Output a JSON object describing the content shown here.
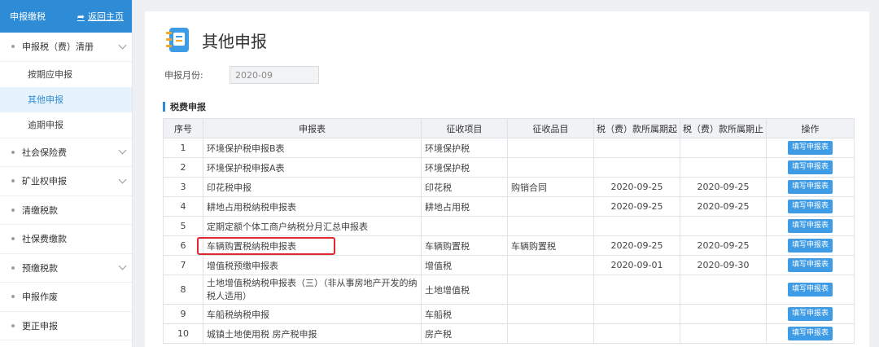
{
  "sidebar": {
    "header_title": "申报缴税",
    "back_label": "返回主页",
    "items": [
      {
        "label": "申报税（费）清册",
        "expandable": true
      },
      {
        "label": "社会保险费",
        "expandable": true
      },
      {
        "label": "矿业权申报",
        "expandable": true
      },
      {
        "label": "清缴税款",
        "expandable": false
      },
      {
        "label": "社保费缴款",
        "expandable": false
      },
      {
        "label": "预缴税款",
        "expandable": true
      },
      {
        "label": "申报作废",
        "expandable": false
      },
      {
        "label": "更正申报",
        "expandable": false
      }
    ],
    "subitems": [
      {
        "label": "按期应申报",
        "active": false
      },
      {
        "label": "其他申报",
        "active": true
      },
      {
        "label": "逾期申报",
        "active": false
      }
    ]
  },
  "main": {
    "title": "其他申报",
    "month_label": "申报月份:",
    "month_value": "2020-09",
    "section_title": "税费申报"
  },
  "table": {
    "headers": [
      "序号",
      "申报表",
      "征收项目",
      "征收品目",
      "税（费）款所属期起",
      "税（费）款所属期止",
      "操作"
    ],
    "rows": [
      {
        "no": "1",
        "form": "环境保护税申报B表",
        "project": "环境保护税",
        "item": "",
        "start": "",
        "end": "",
        "action": "填写申报表"
      },
      {
        "no": "2",
        "form": "环境保护税申报A表",
        "project": "环境保护税",
        "item": "",
        "start": "",
        "end": "",
        "action": "填写申报表"
      },
      {
        "no": "3",
        "form": "印花税申报",
        "project": "印花税",
        "item": "购销合同",
        "start": "2020-09-25",
        "end": "2020-09-25",
        "action": "填写申报表"
      },
      {
        "no": "4",
        "form": "耕地占用税纳税申报表",
        "project": "耕地占用税",
        "item": "",
        "start": "2020-09-25",
        "end": "2020-09-25",
        "action": "填写申报表"
      },
      {
        "no": "5",
        "form": "定期定额个体工商户纳税分月汇总申报表",
        "project": "",
        "item": "",
        "start": "",
        "end": "",
        "action": "填写申报表"
      },
      {
        "no": "6",
        "form": "车辆购置税纳税申报表",
        "project": "车辆购置税",
        "item": "车辆购置税",
        "start": "2020-09-25",
        "end": "2020-09-25",
        "action": "填写申报表"
      },
      {
        "no": "7",
        "form": "增值税预缴申报表",
        "project": "增值税",
        "item": "",
        "start": "2020-09-01",
        "end": "2020-09-30",
        "action": "填写申报表"
      },
      {
        "no": "8",
        "form": "土地增值税纳税申报表（三）（非从事房地产开发的纳税人适用）",
        "project": "土地增值税",
        "item": "",
        "start": "",
        "end": "",
        "action": "填写申报表"
      },
      {
        "no": "9",
        "form": "车船税纳税申报",
        "project": "车船税",
        "item": "",
        "start": "",
        "end": "",
        "action": "填写申报表"
      },
      {
        "no": "10",
        "form": "城镇土地使用税 房产税申报",
        "project": "房产税",
        "item": "",
        "start": "",
        "end": "",
        "action": "填写申报表"
      }
    ]
  },
  "colors": {
    "accent": "#2e8cd6",
    "button": "#3e9be6",
    "highlight": "#e0262f"
  }
}
